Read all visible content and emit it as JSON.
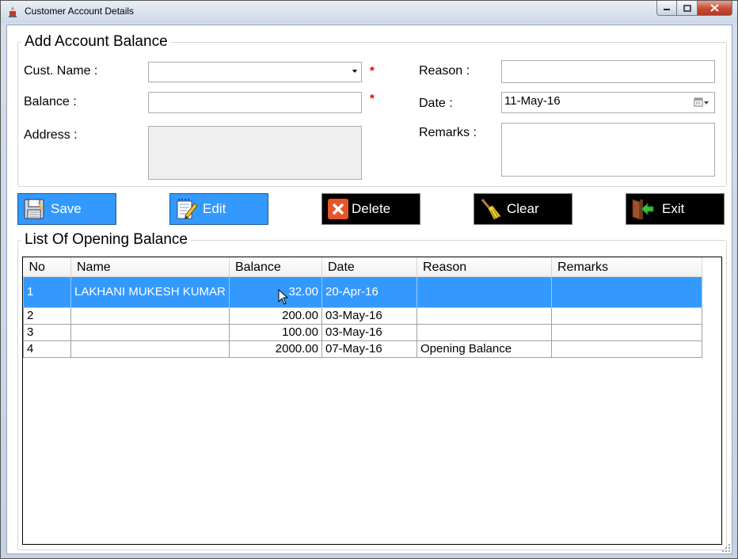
{
  "window": {
    "title": "Customer Account Details",
    "min_icon": "minimize-icon",
    "max_icon": "maximize-icon",
    "close_icon": "close-icon"
  },
  "form": {
    "group_title": "Add Account Balance",
    "cust_name_label": "Cust. Name :",
    "cust_name_value": "",
    "balance_label": "Balance :",
    "balance_value": "",
    "address_label": "Address :",
    "address_value": "",
    "reason_label": "Reason :",
    "reason_value": "",
    "date_label": "Date :",
    "date_value": "11-May-16",
    "remarks_label": "Remarks :",
    "remarks_value": "",
    "required_mark": "*"
  },
  "buttons": {
    "save": "Save",
    "edit": "Edit",
    "delete": "Delete",
    "clear": "Clear",
    "exit": "Exit"
  },
  "list": {
    "group_title": "List Of Opening Balance",
    "columns": [
      "No",
      "Name",
      "Balance",
      "Date",
      "Reason",
      "Remarks"
    ],
    "rows": [
      {
        "no": "1",
        "name": "LAKHANI MUKESH KUMAR",
        "balance": "32.00",
        "date": "20-Apr-16",
        "reason": "",
        "remarks": "",
        "selected": true
      },
      {
        "no": "2",
        "name": "",
        "balance": "200.00",
        "date": "03-May-16",
        "reason": "",
        "remarks": "",
        "selected": false
      },
      {
        "no": "3",
        "name": "",
        "balance": "100.00",
        "date": "03-May-16",
        "reason": "",
        "remarks": "",
        "selected": false
      },
      {
        "no": "4",
        "name": "",
        "balance": "2000.00",
        "date": "07-May-16",
        "reason": "Opening Balance",
        "remarks": "",
        "selected": false
      }
    ]
  },
  "colors": {
    "button_blue": "#3399ff",
    "button_black": "#000000",
    "selection": "#3399ff",
    "required": "#e00000"
  }
}
